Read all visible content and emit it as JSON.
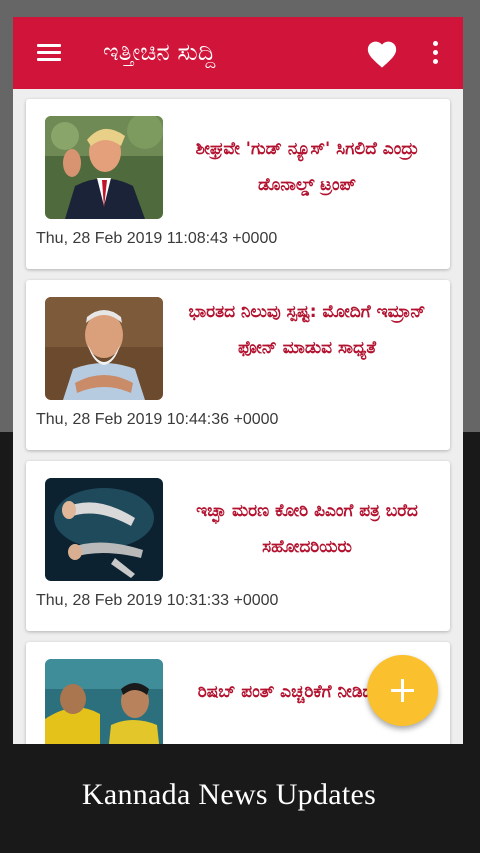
{
  "colors": {
    "accent": "#d0143a",
    "headline": "#b3122f",
    "fab": "#fbc02d"
  },
  "appbar": {
    "title": "ಇತ್ತೀಚಿನ ಸುದ್ದಿ",
    "menu_icon": "hamburger-menu-icon",
    "favorite_icon": "heart-icon",
    "more_icon": "more-vert-icon"
  },
  "news": [
    {
      "headline": "ಶೀಘ್ರವೇ 'ಗುಡ್ ನ್ಯೂಸ್' ಸಿಗಲಿದೆ ಎಂದ್ರು ಡೊನಾಲ್ಡ್ ಟ್ರಂಪ್",
      "date": "Thu, 28 Feb 2019 11:08:43 +0000"
    },
    {
      "headline": "ಭಾರತದ ನಿಲುವು ಸ್ಪಷ್ಟ: ಮೋದಿಗೆ ಇಮ್ರಾನ್ ಫೋನ್ ಮಾಡುವ ಸಾಧ್ಯತೆ",
      "date": "Thu, 28 Feb 2019 10:44:36 +0000"
    },
    {
      "headline": "ಇಚ್ಛಾ ಮರಣ ಕೋರಿ ಪಿಎಂಗೆ ಪತ್ರ ಬರೆದ ಸಹೋದರಿಯರು",
      "date": "Thu, 28 Feb 2019 10:31:33 +0000"
    },
    {
      "headline": "ರಿಷಬ್ ಪಂತ್ ಎಚ್ಚರಿಕೆಗೆ ನೀಡಿದ ಧೋನಿ",
      "date": ""
    }
  ],
  "fab": {
    "icon": "plus-icon"
  },
  "caption": "Kannada News Updates"
}
